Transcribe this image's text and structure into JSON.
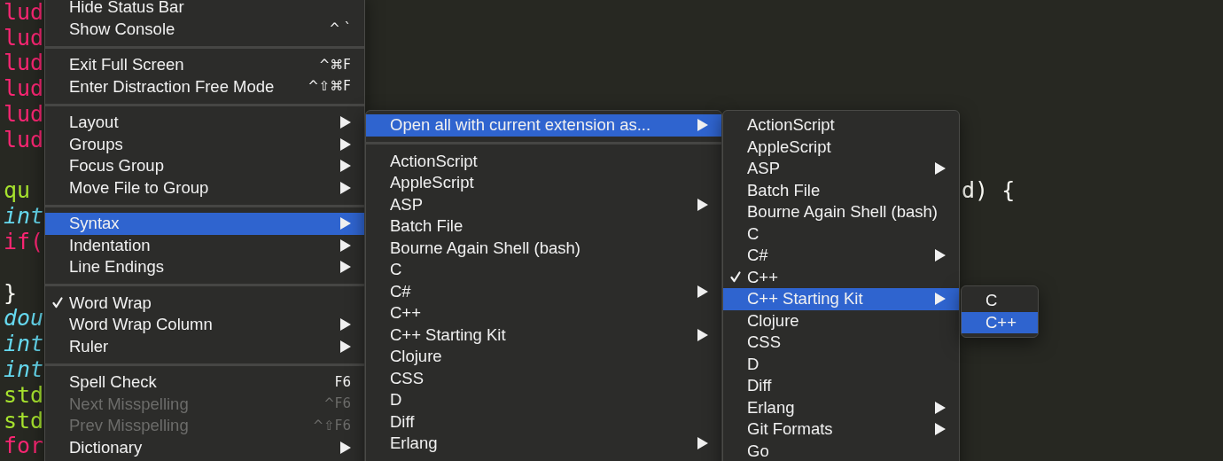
{
  "editor": {
    "lines": [
      {
        "kind": "keyword",
        "text": "lud"
      },
      {
        "kind": "keyword",
        "text": "lud"
      },
      {
        "kind": "keyword",
        "text": "lud"
      },
      {
        "kind": "keyword",
        "text": "lud"
      },
      {
        "kind": "keyword",
        "text": "lud"
      },
      {
        "kind": "keyword",
        "text": "lud"
      },
      {
        "kind": "blank"
      },
      {
        "kind": "name",
        "text": "qu",
        "tail": "d) {"
      },
      {
        "kind": "type",
        "text": "int"
      },
      {
        "kind": "keyword",
        "text": "if("
      },
      {
        "kind": "blank"
      },
      {
        "kind": "plain",
        "text": "}"
      },
      {
        "kind": "type",
        "text": "dou"
      },
      {
        "kind": "type",
        "text": "int"
      },
      {
        "kind": "type",
        "text": "int"
      },
      {
        "kind": "name",
        "text": "std"
      },
      {
        "kind": "name",
        "text": "std"
      },
      {
        "kind": "keyword",
        "text": "for"
      }
    ]
  },
  "menus": [
    {
      "items": [
        {
          "kind": "item",
          "label": "Hide Status Bar",
          "selected": false,
          "checked": false,
          "disabled": false,
          "submenu": false
        },
        {
          "kind": "item",
          "label": "Show Console",
          "shortcut": "^ `",
          "selected": false,
          "checked": false,
          "disabled": false,
          "submenu": false
        },
        {
          "kind": "separator"
        },
        {
          "kind": "item",
          "label": "Exit Full Screen",
          "shortcut": "^⌘F",
          "selected": false,
          "checked": false,
          "disabled": false,
          "submenu": false
        },
        {
          "kind": "item",
          "label": "Enter Distraction Free Mode",
          "shortcut": "^⇧⌘F",
          "selected": false,
          "checked": false,
          "disabled": false,
          "submenu": false
        },
        {
          "kind": "separator"
        },
        {
          "kind": "item",
          "label": "Layout",
          "selected": false,
          "checked": false,
          "disabled": false,
          "submenu": true
        },
        {
          "kind": "item",
          "label": "Groups",
          "selected": false,
          "checked": false,
          "disabled": false,
          "submenu": true
        },
        {
          "kind": "item",
          "label": "Focus Group",
          "selected": false,
          "checked": false,
          "disabled": false,
          "submenu": true
        },
        {
          "kind": "item",
          "label": "Move File to Group",
          "selected": false,
          "checked": false,
          "disabled": false,
          "submenu": true
        },
        {
          "kind": "separator"
        },
        {
          "kind": "item",
          "label": "Syntax",
          "selected": true,
          "checked": false,
          "disabled": false,
          "submenu": true
        },
        {
          "kind": "item",
          "label": "Indentation",
          "selected": false,
          "checked": false,
          "disabled": false,
          "submenu": true
        },
        {
          "kind": "item",
          "label": "Line Endings",
          "selected": false,
          "checked": false,
          "disabled": false,
          "submenu": true
        },
        {
          "kind": "separator"
        },
        {
          "kind": "item",
          "label": "Word Wrap",
          "selected": false,
          "checked": true,
          "disabled": false,
          "submenu": false
        },
        {
          "kind": "item",
          "label": "Word Wrap Column",
          "selected": false,
          "checked": false,
          "disabled": false,
          "submenu": true
        },
        {
          "kind": "item",
          "label": "Ruler",
          "selected": false,
          "checked": false,
          "disabled": false,
          "submenu": true
        },
        {
          "kind": "separator"
        },
        {
          "kind": "item",
          "label": "Spell Check",
          "shortcut": "F6",
          "selected": false,
          "checked": false,
          "disabled": false,
          "submenu": false
        },
        {
          "kind": "item",
          "label": "Next Misspelling",
          "shortcut": "^F6",
          "selected": false,
          "checked": false,
          "disabled": true,
          "submenu": false
        },
        {
          "kind": "item",
          "label": "Prev Misspelling",
          "shortcut": "^⇧F6",
          "selected": false,
          "checked": false,
          "disabled": true,
          "submenu": false
        },
        {
          "kind": "item",
          "label": "Dictionary",
          "selected": false,
          "checked": false,
          "disabled": false,
          "submenu": true
        }
      ]
    },
    {
      "items": [
        {
          "kind": "item",
          "label": "Open all with current extension as...",
          "selected": true,
          "checked": false,
          "disabled": false,
          "submenu": true
        },
        {
          "kind": "separator"
        },
        {
          "kind": "item",
          "label": "ActionScript",
          "selected": false,
          "checked": false,
          "disabled": false,
          "submenu": false
        },
        {
          "kind": "item",
          "label": "AppleScript",
          "selected": false,
          "checked": false,
          "disabled": false,
          "submenu": false
        },
        {
          "kind": "item",
          "label": "ASP",
          "selected": false,
          "checked": false,
          "disabled": false,
          "submenu": true
        },
        {
          "kind": "item",
          "label": "Batch File",
          "selected": false,
          "checked": false,
          "disabled": false,
          "submenu": false
        },
        {
          "kind": "item",
          "label": "Bourne Again Shell (bash)",
          "selected": false,
          "checked": false,
          "disabled": false,
          "submenu": false
        },
        {
          "kind": "item",
          "label": "C",
          "selected": false,
          "checked": false,
          "disabled": false,
          "submenu": false
        },
        {
          "kind": "item",
          "label": "C#",
          "selected": false,
          "checked": false,
          "disabled": false,
          "submenu": true
        },
        {
          "kind": "item",
          "label": "C++",
          "selected": false,
          "checked": false,
          "disabled": false,
          "submenu": false
        },
        {
          "kind": "item",
          "label": "C++ Starting Kit",
          "selected": false,
          "checked": false,
          "disabled": false,
          "submenu": true
        },
        {
          "kind": "item",
          "label": "Clojure",
          "selected": false,
          "checked": false,
          "disabled": false,
          "submenu": false
        },
        {
          "kind": "item",
          "label": "CSS",
          "selected": false,
          "checked": false,
          "disabled": false,
          "submenu": false
        },
        {
          "kind": "item",
          "label": "D",
          "selected": false,
          "checked": false,
          "disabled": false,
          "submenu": false
        },
        {
          "kind": "item",
          "label": "Diff",
          "selected": false,
          "checked": false,
          "disabled": false,
          "submenu": false
        },
        {
          "kind": "item",
          "label": "Erlang",
          "selected": false,
          "checked": false,
          "disabled": false,
          "submenu": true
        }
      ]
    },
    {
      "items": [
        {
          "kind": "item",
          "label": "ActionScript",
          "selected": false,
          "checked": false,
          "disabled": false,
          "submenu": false
        },
        {
          "kind": "item",
          "label": "AppleScript",
          "selected": false,
          "checked": false,
          "disabled": false,
          "submenu": false
        },
        {
          "kind": "item",
          "label": "ASP",
          "selected": false,
          "checked": false,
          "disabled": false,
          "submenu": true
        },
        {
          "kind": "item",
          "label": "Batch File",
          "selected": false,
          "checked": false,
          "disabled": false,
          "submenu": false
        },
        {
          "kind": "item",
          "label": "Bourne Again Shell (bash)",
          "selected": false,
          "checked": false,
          "disabled": false,
          "submenu": false
        },
        {
          "kind": "item",
          "label": "C",
          "selected": false,
          "checked": false,
          "disabled": false,
          "submenu": false
        },
        {
          "kind": "item",
          "label": "C#",
          "selected": false,
          "checked": false,
          "disabled": false,
          "submenu": true
        },
        {
          "kind": "item",
          "label": "C++",
          "selected": false,
          "checked": true,
          "disabled": false,
          "submenu": false
        },
        {
          "kind": "item",
          "label": "C++ Starting Kit",
          "selected": true,
          "checked": false,
          "disabled": false,
          "submenu": true
        },
        {
          "kind": "item",
          "label": "Clojure",
          "selected": false,
          "checked": false,
          "disabled": false,
          "submenu": false
        },
        {
          "kind": "item",
          "label": "CSS",
          "selected": false,
          "checked": false,
          "disabled": false,
          "submenu": false
        },
        {
          "kind": "item",
          "label": "D",
          "selected": false,
          "checked": false,
          "disabled": false,
          "submenu": false
        },
        {
          "kind": "item",
          "label": "Diff",
          "selected": false,
          "checked": false,
          "disabled": false,
          "submenu": false
        },
        {
          "kind": "item",
          "label": "Erlang",
          "selected": false,
          "checked": false,
          "disabled": false,
          "submenu": true
        },
        {
          "kind": "item",
          "label": "Git Formats",
          "selected": false,
          "checked": false,
          "disabled": false,
          "submenu": true
        },
        {
          "kind": "item",
          "label": "Go",
          "selected": false,
          "checked": false,
          "disabled": false,
          "submenu": false
        }
      ]
    },
    {
      "items": [
        {
          "kind": "item",
          "label": "C",
          "selected": false,
          "checked": false,
          "disabled": false,
          "submenu": false
        },
        {
          "kind": "item",
          "label": "C++",
          "selected": true,
          "checked": false,
          "disabled": false,
          "submenu": false
        }
      ]
    }
  ]
}
